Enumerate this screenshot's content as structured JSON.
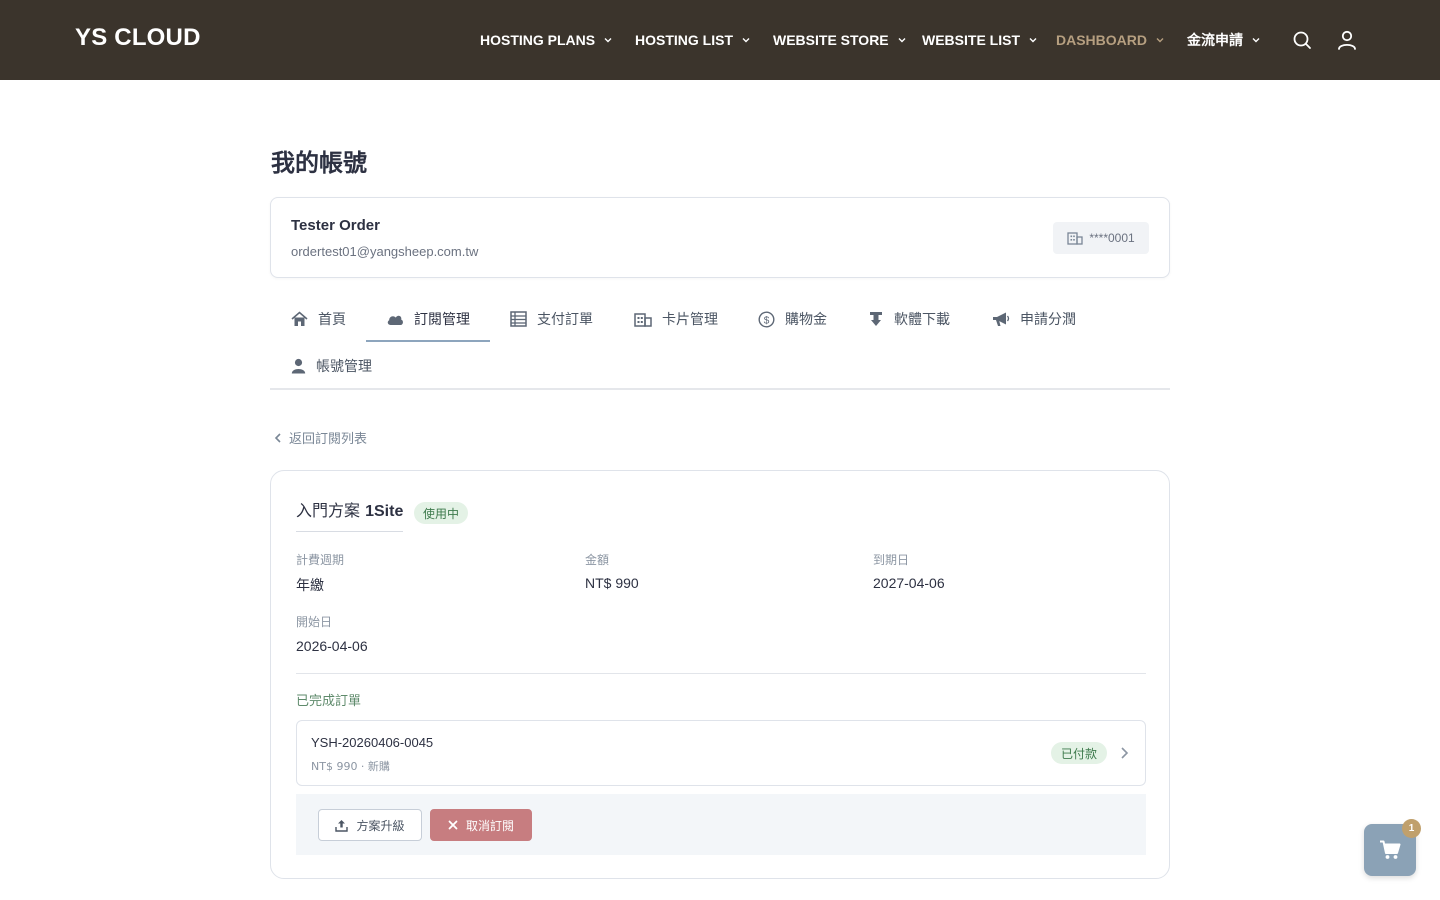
{
  "brand": "YS CLOUD",
  "nav": {
    "hosting_plans": "HOSTING PLANS",
    "hosting_list": "HOSTING LIST",
    "website_store": "WEBSITE STORE",
    "website_list": "WEBSITE LIST",
    "dashboard": "DASHBOARD",
    "payment_apply": "金流申請"
  },
  "icons": {
    "search": "search-icon",
    "user": "user-icon",
    "cart": "cart-icon"
  },
  "page_title": "我的帳號",
  "user": {
    "name": "Tester Order",
    "email": "ordertest01@yangsheep.com.tw",
    "account_masked": "****0001"
  },
  "tabs": [
    {
      "label": "首頁",
      "icon": "home-icon"
    },
    {
      "label": "訂閱管理",
      "icon": "cloud-icon",
      "active": true
    },
    {
      "label": "支付訂單",
      "icon": "list-icon"
    },
    {
      "label": "卡片管理",
      "icon": "building-icon"
    },
    {
      "label": "購物金",
      "icon": "dollar-icon"
    },
    {
      "label": "軟體下載",
      "icon": "download-icon"
    },
    {
      "label": "申請分潤",
      "icon": "megaphone-icon"
    },
    {
      "label": "帳號管理",
      "icon": "user-icon"
    }
  ],
  "back_link": "返回訂閱列表",
  "subscription": {
    "plan_name_prefix": "入門方案",
    "plan_name_bold": "1Site",
    "status": "使用中",
    "fields": {
      "billing_cycle_label": "計費週期",
      "billing_cycle_value": "年繳",
      "amount_label": "金額",
      "amount_value": "NT$ 990",
      "expiry_label": "到期日",
      "expiry_value": "2027-04-06",
      "start_label": "開始日",
      "start_value": "2026-04-06"
    },
    "completed_orders_title": "已完成訂單",
    "order": {
      "id": "YSH-20260406-0045",
      "meta": "NT$ 990 · 新購",
      "status": "已付款"
    },
    "actions": {
      "upgrade": "方案升級",
      "cancel": "取消訂閱"
    }
  },
  "cart": {
    "count": "1"
  },
  "colors": {
    "topbar": "#3b342c",
    "nav_active": "#b69f80",
    "status_green_bg": "#e4f2e6",
    "status_green_text": "#3d7a4c",
    "cancel_button": "#c77d80",
    "cart_fab": "#8ba2b6",
    "cart_badge": "#c0a06c"
  }
}
